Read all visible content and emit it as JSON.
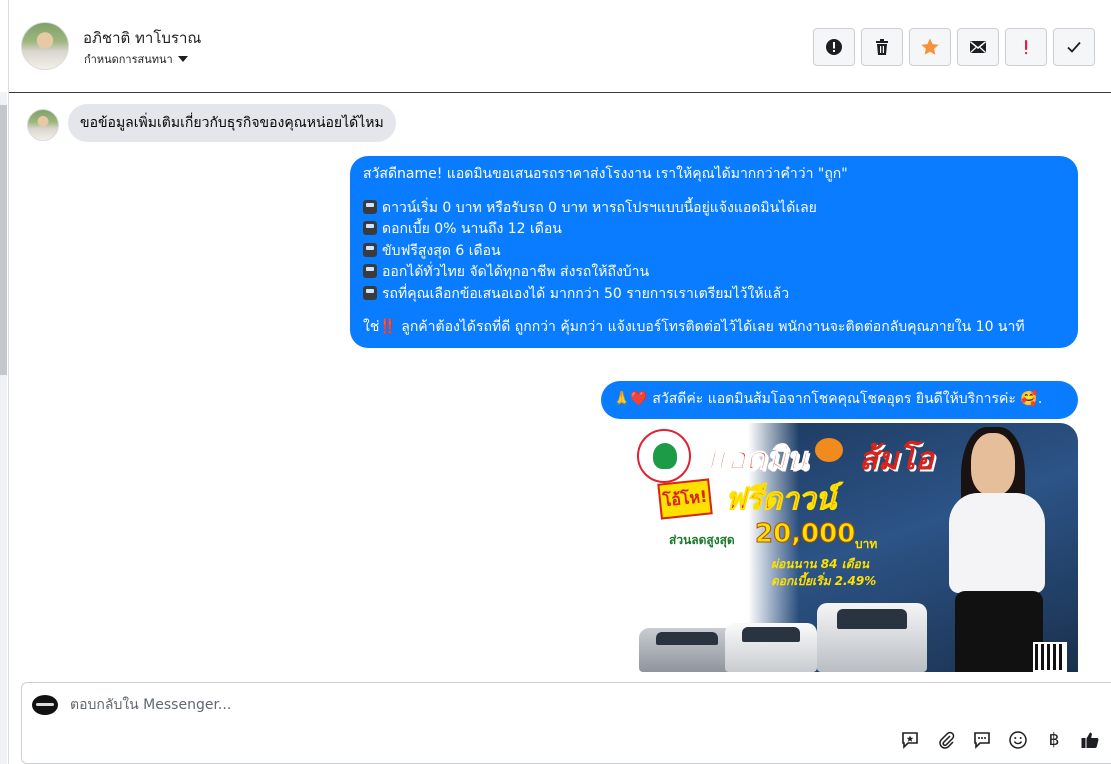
{
  "header": {
    "contact_name": "อภิชาติ ทาโบราณ",
    "subtitle": "กำหนดการสนทนา",
    "tools": [
      {
        "icon": "alert-circle-icon"
      },
      {
        "icon": "trash-icon"
      },
      {
        "icon": "star-icon",
        "color": "#f7923b"
      },
      {
        "icon": "mail-icon"
      },
      {
        "icon": "exclamation-icon",
        "color": "#e41e3f"
      },
      {
        "icon": "check-icon"
      }
    ]
  },
  "thread": {
    "incoming": {
      "text": "ขอข้อมูลเพิ่มเติมเกี่ยวกับธุรกิจของคุณหน่อยได้ไหม"
    },
    "outgoing_1": {
      "lines": [
        "สวัสดีname! แอดมินขอเสนอรถราคาส่งโรงงาน เราให้คุณได้มากกว่าคำว่า \"ถูก\"",
        "ดาวน์เริ่ม 0 บาท หรือรับรถ 0 บาท หารถโปรฯแบบนี้อยู่แจ้งแอดมินได้เลย",
        "ดอกเบี้ย 0% นานถึง 12 เดือน",
        "ขับฟรีสูงสุด 6 เดือน",
        "ออกได้ทั่วไทย จัดได้ทุกอาชีพ ส่งรถให้ถึงบ้าน",
        "รถที่คุณเลือกข้อเสนอเองได้ มากกว่า 50 รายการเราเตรียมไว้ให้แล้ว",
        "ใช่",
        "ลูกค้าต้องได้รถที่ดี ถูกกว่า คุ้มกว่า แจ้งเบอร์โทรติดต่อไว้ได้เลย พนักงานจะติดต่อกลับคุณภายใน 10 นาที"
      ],
      "bang_emoji": "‼️"
    },
    "outgoing_2": {
      "prefix_emoji": "🙏❤️",
      "text": "สวัสดีค่ะ แอดมินส้มโอจากโชคคุณโชคอุดร ยินดีให้บริการค่ะ",
      "suffix_emoji": "🥰."
    },
    "promo_image": {
      "title_left": "แอดมิน",
      "title_right": "ส้มโอ",
      "tag": "โอ้โห!",
      "headline": "ฟรีดาวน์",
      "discount_label": "ส่วนลดสูงสุด",
      "discount_amount": "20,000",
      "discount_unit": "บาท",
      "installment": "ผ่อนนาน 84 เดือน",
      "interest": "ดอกเบี้ยเริ่ม 2.49%"
    }
  },
  "composer": {
    "placeholder": "ตอบกลับใน Messenger...",
    "tools": [
      "quick-reply-icon",
      "attachment-icon",
      "saved-reply-icon",
      "emoji-icon",
      "baht-icon",
      "like-icon"
    ],
    "baht_symbol": "฿"
  },
  "colors": {
    "outgoing_bubble": "#0a7cff",
    "incoming_bubble": "#e4e6eb",
    "like_button": "#1c1e21"
  }
}
